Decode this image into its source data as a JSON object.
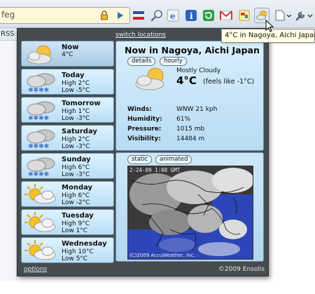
{
  "browser": {
    "url_fragment": "feg",
    "tab_label": "RSS",
    "tooltip": "4°C in Nagoya, Aichi Japan"
  },
  "colors": {
    "popup_bg": "#464b50",
    "card_bg": "#c8e8fa",
    "link": "#e6eef6",
    "urlbar": "#fff8d8"
  },
  "icons": [
    "lock-icon",
    "go-arrow-icon",
    "flag-icon",
    "magnifier-icon",
    "ie-icon",
    "info-icon",
    "refresh-icon",
    "gmail-icon",
    "notes-icon",
    "weather-icon",
    "page-menu-icon",
    "wrench-menu-icon"
  ],
  "popup": {
    "switch_locations": "switch locations",
    "options": "options",
    "copyright": "©2009 Ensolis"
  },
  "forecast": [
    {
      "day": "Now",
      "line1": "4°C",
      "line2": "",
      "icon": "partly-cloudy-icon"
    },
    {
      "day": "Today",
      "line1": "High 2°C",
      "line2": "Low -5°C",
      "icon": "snow-cloud-icon"
    },
    {
      "day": "Tomorrow",
      "line1": "High 1°C",
      "line2": "Low -3°C",
      "icon": "snow-cloud-icon"
    },
    {
      "day": "Saturday",
      "line1": "High 2°C",
      "line2": "Low -3°C",
      "icon": "snow-cloud-icon"
    },
    {
      "day": "Sunday",
      "line1": "High 6°C",
      "line2": "Low -3°C",
      "icon": "snow-cloud-icon"
    },
    {
      "day": "Monday",
      "line1": "High 6°C",
      "line2": "Low -2°C",
      "icon": "sun-cloud-icon"
    },
    {
      "day": "Tuesday",
      "line1": "High 9°C",
      "line2": "Low 1°C",
      "icon": "sun-cloud-icon"
    },
    {
      "day": "Wednesday",
      "line1": "High 10°C",
      "line2": "Low 5°C",
      "icon": "sun-cloud-icon"
    }
  ],
  "now": {
    "title": "Now in Nagoya, Aichi Japan",
    "details_btn": "details",
    "hourly_btn": "hourly",
    "condition": "Mostly Cloudy",
    "temp": "4°C",
    "feels_like": "(feels like -1°C)",
    "details": [
      {
        "label": "Winds:",
        "value": "WNW 21 kph"
      },
      {
        "label": "Humidity:",
        "value": "61%"
      },
      {
        "label": "Pressure:",
        "value": "1015 mb"
      },
      {
        "label": "Visibility:",
        "value": "14484 m"
      }
    ]
  },
  "map": {
    "static_btn": "static",
    "animated_btn": "animated",
    "stamp": "2-24-09 1:00 GMT",
    "credit": "(C)2009 AccuWeather, Inc."
  }
}
